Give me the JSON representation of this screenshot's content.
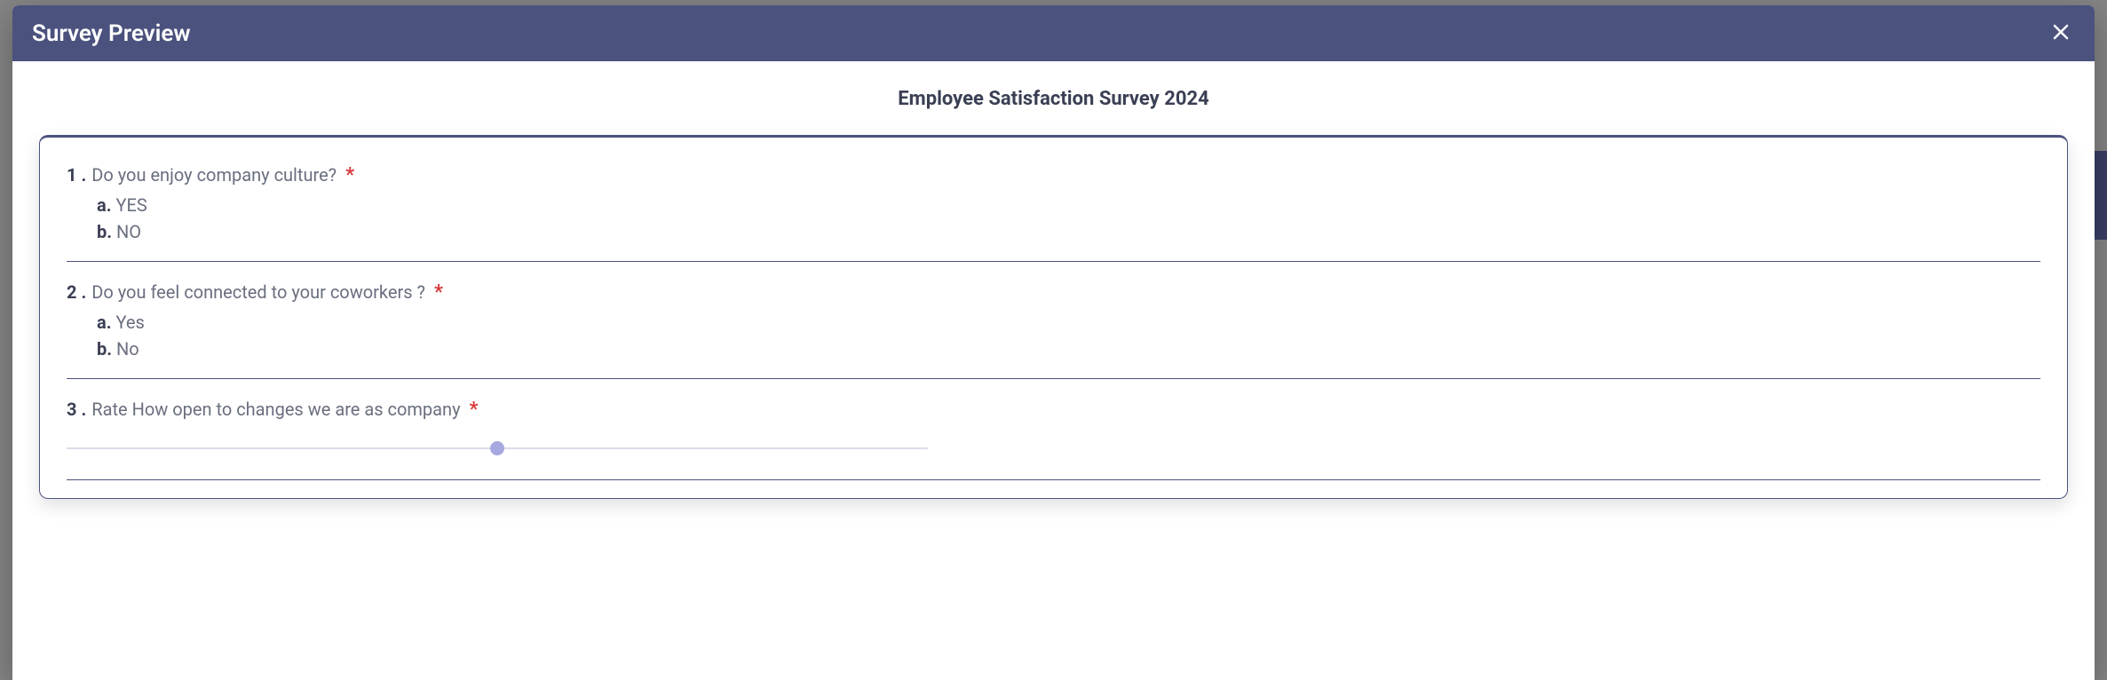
{
  "modal": {
    "title": "Survey Preview"
  },
  "survey": {
    "title": "Employee Satisfaction Survey 2024"
  },
  "questions": [
    {
      "num": "1 .",
      "text": "Do you enjoy company culture?",
      "required": "*",
      "options": [
        {
          "letter": "a.",
          "text": "YES"
        },
        {
          "letter": "b.",
          "text": "NO"
        }
      ]
    },
    {
      "num": "2 .",
      "text": "Do you feel connected to your coworkers ?",
      "required": "*",
      "options": [
        {
          "letter": "a.",
          "text": "Yes"
        },
        {
          "letter": "b.",
          "text": "No"
        }
      ]
    },
    {
      "num": "3 .",
      "text": "Rate How open to changes we are as company",
      "required": "*"
    }
  ],
  "slider": {
    "percent": 50
  }
}
